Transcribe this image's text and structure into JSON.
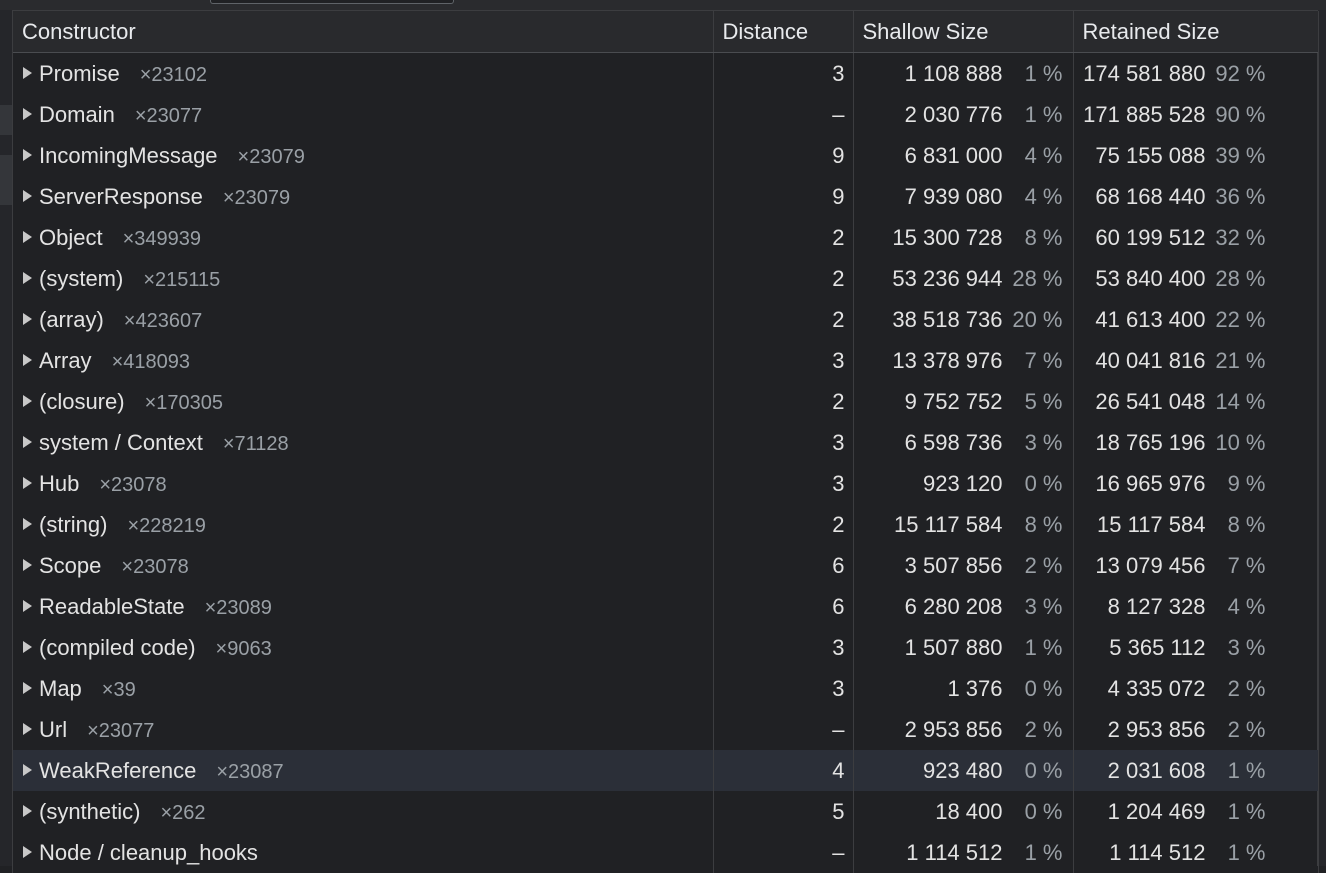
{
  "header": {
    "constructor": "Constructor",
    "distance": "Distance",
    "shallow_size": "Shallow Size",
    "retained_size": "Retained Size"
  },
  "colors": {
    "background": "#202124",
    "header_background": "#292a2d",
    "selected_row": "#2b2f38",
    "muted_text": "#9aa0a6"
  },
  "rows": [
    {
      "name": "Promise",
      "count": "×23102",
      "distance": "3",
      "shallow": "1 108 888",
      "shallow_pct": "1 %",
      "retained": "174 581 880",
      "retained_pct": "92 %"
    },
    {
      "name": "Domain",
      "count": "×23077",
      "distance": "–",
      "shallow": "2 030 776",
      "shallow_pct": "1 %",
      "retained": "171 885 528",
      "retained_pct": "90 %"
    },
    {
      "name": "IncomingMessage",
      "count": "×23079",
      "distance": "9",
      "shallow": "6 831 000",
      "shallow_pct": "4 %",
      "retained": "75 155 088",
      "retained_pct": "39 %"
    },
    {
      "name": "ServerResponse",
      "count": "×23079",
      "distance": "9",
      "shallow": "7 939 080",
      "shallow_pct": "4 %",
      "retained": "68 168 440",
      "retained_pct": "36 %"
    },
    {
      "name": "Object",
      "count": "×349939",
      "distance": "2",
      "shallow": "15 300 728",
      "shallow_pct": "8 %",
      "retained": "60 199 512",
      "retained_pct": "32 %"
    },
    {
      "name": "(system)",
      "count": "×215115",
      "distance": "2",
      "shallow": "53 236 944",
      "shallow_pct": "28 %",
      "retained": "53 840 400",
      "retained_pct": "28 %"
    },
    {
      "name": "(array)",
      "count": "×423607",
      "distance": "2",
      "shallow": "38 518 736",
      "shallow_pct": "20 %",
      "retained": "41 613 400",
      "retained_pct": "22 %"
    },
    {
      "name": "Array",
      "count": "×418093",
      "distance": "3",
      "shallow": "13 378 976",
      "shallow_pct": "7 %",
      "retained": "40 041 816",
      "retained_pct": "21 %"
    },
    {
      "name": "(closure)",
      "count": "×170305",
      "distance": "2",
      "shallow": "9 752 752",
      "shallow_pct": "5 %",
      "retained": "26 541 048",
      "retained_pct": "14 %"
    },
    {
      "name": "system / Context",
      "count": "×71128",
      "distance": "3",
      "shallow": "6 598 736",
      "shallow_pct": "3 %",
      "retained": "18 765 196",
      "retained_pct": "10 %"
    },
    {
      "name": "Hub",
      "count": "×23078",
      "distance": "3",
      "shallow": "923 120",
      "shallow_pct": "0 %",
      "retained": "16 965 976",
      "retained_pct": "9 %"
    },
    {
      "name": "(string)",
      "count": "×228219",
      "distance": "2",
      "shallow": "15 117 584",
      "shallow_pct": "8 %",
      "retained": "15 117 584",
      "retained_pct": "8 %"
    },
    {
      "name": "Scope",
      "count": "×23078",
      "distance": "6",
      "shallow": "3 507 856",
      "shallow_pct": "2 %",
      "retained": "13 079 456",
      "retained_pct": "7 %"
    },
    {
      "name": "ReadableState",
      "count": "×23089",
      "distance": "6",
      "shallow": "6 280 208",
      "shallow_pct": "3 %",
      "retained": "8 127 328",
      "retained_pct": "4 %"
    },
    {
      "name": "(compiled code)",
      "count": "×9063",
      "distance": "3",
      "shallow": "1 507 880",
      "shallow_pct": "1 %",
      "retained": "5 365 112",
      "retained_pct": "3 %"
    },
    {
      "name": "Map",
      "count": "×39",
      "distance": "3",
      "shallow": "1 376",
      "shallow_pct": "0 %",
      "retained": "4 335 072",
      "retained_pct": "2 %"
    },
    {
      "name": "Url",
      "count": "×23077",
      "distance": "–",
      "shallow": "2 953 856",
      "shallow_pct": "2 %",
      "retained": "2 953 856",
      "retained_pct": "2 %"
    },
    {
      "name": "WeakReference",
      "count": "×23087",
      "distance": "4",
      "shallow": "923 480",
      "shallow_pct": "0 %",
      "retained": "2 031 608",
      "retained_pct": "1 %",
      "selected": true
    },
    {
      "name": "(synthetic)",
      "count": "×262",
      "distance": "5",
      "shallow": "18 400",
      "shallow_pct": "0 %",
      "retained": "1 204 469",
      "retained_pct": "1 %"
    },
    {
      "name": "Node / cleanup_hooks",
      "count": "",
      "distance": "–",
      "shallow": "1 114 512",
      "shallow_pct": "1 %",
      "retained": "1 114 512",
      "retained_pct": "1 %"
    }
  ]
}
